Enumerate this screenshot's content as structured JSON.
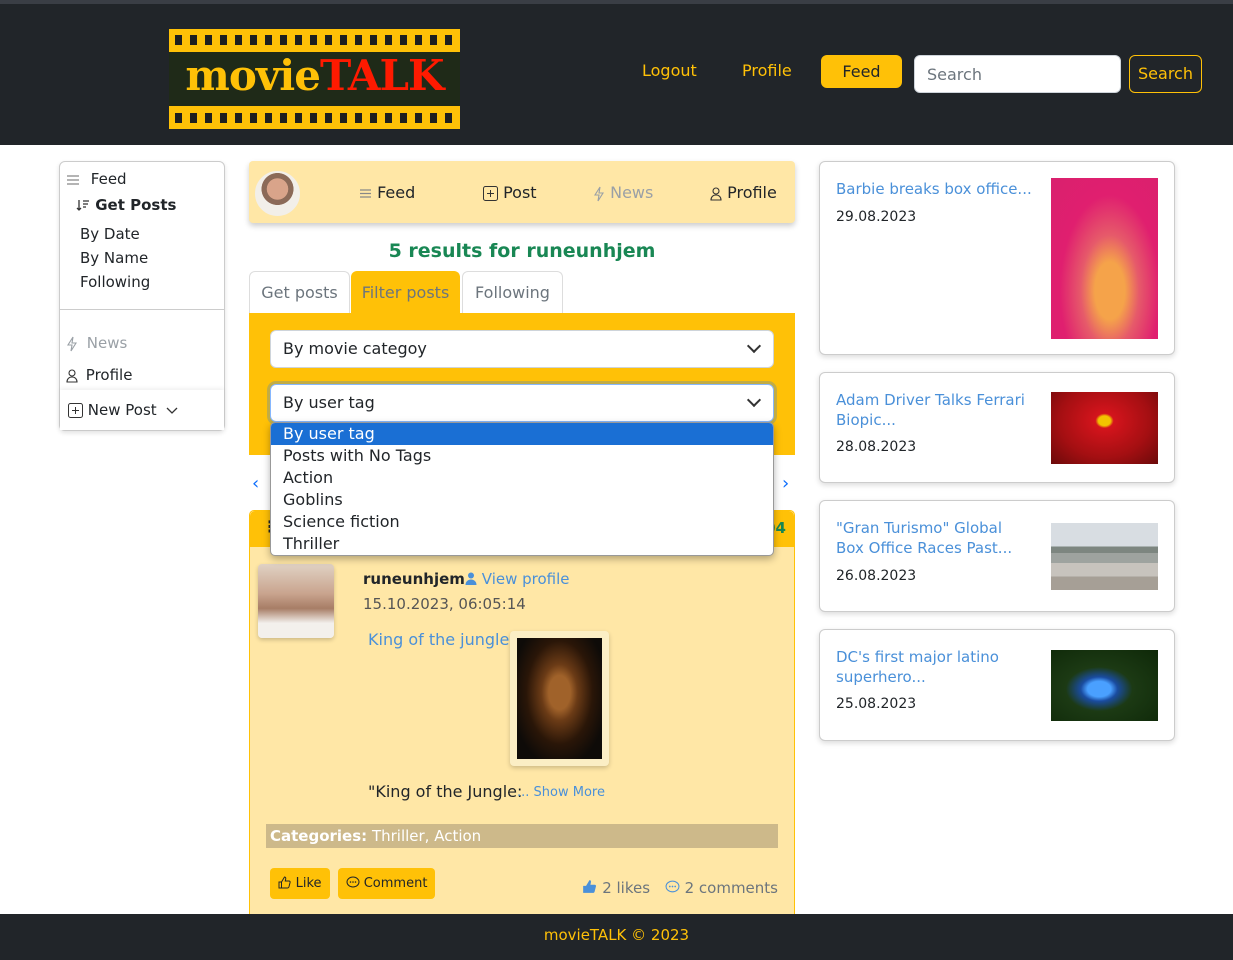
{
  "header": {
    "logo_part1": "movie",
    "logo_part2": "TALK",
    "nav": {
      "logout": "Logout",
      "profile": "Profile",
      "feed": "Feed"
    },
    "search": {
      "placeholder": "Search",
      "button": "Search"
    }
  },
  "sidebar": {
    "feed": "Feed",
    "get_posts": "Get Posts",
    "by_date": "By Date",
    "by_name": "By Name",
    "following": "Following",
    "news": "News",
    "profile": "Profile",
    "new_post": "New Post"
  },
  "subnav": {
    "feed": "Feed",
    "post": "Post",
    "news": "News",
    "profile": "Profile"
  },
  "results_text": "5 results for runeunhjem",
  "tabs": [
    "Get posts",
    "Filter posts",
    "Following"
  ],
  "filters": {
    "category_select": "By movie categoy",
    "tag_select": "By user tag",
    "tag_options": [
      "By user tag",
      "Posts with No Tags",
      "Action",
      "Goblins",
      "Science fiction",
      "Thriller"
    ]
  },
  "post": {
    "header_number_partial": "04",
    "username": "runeunhjem",
    "view_profile": "View profile",
    "date": "15.10.2023, 06:05:14",
    "title": "King of the jungle",
    "excerpt": "\"King of the Jungle:",
    "show_more": "... Show More",
    "categories_label": "Categories:",
    "categories_value": "Thriller, Action",
    "like_button": "Like",
    "comment_button": "Comment",
    "likes": "2 likes",
    "comments": "2 comments"
  },
  "news": [
    {
      "title": "Barbie breaks box office...",
      "date": "29.08.2023"
    },
    {
      "title": "Adam Driver Talks Ferrari Biopic...",
      "date": "28.08.2023"
    },
    {
      "title": "\"Gran Turismo\" Global Box Office Races Past...",
      "date": "26.08.2023"
    },
    {
      "title": "DC's first major latino superhero...",
      "date": "25.08.2023"
    }
  ],
  "footer": "movieTALK © 2023",
  "colors": {
    "brand_yellow": "#ffc107",
    "dark": "#212529",
    "link_blue": "#4a90d9",
    "success_green": "#198754"
  }
}
